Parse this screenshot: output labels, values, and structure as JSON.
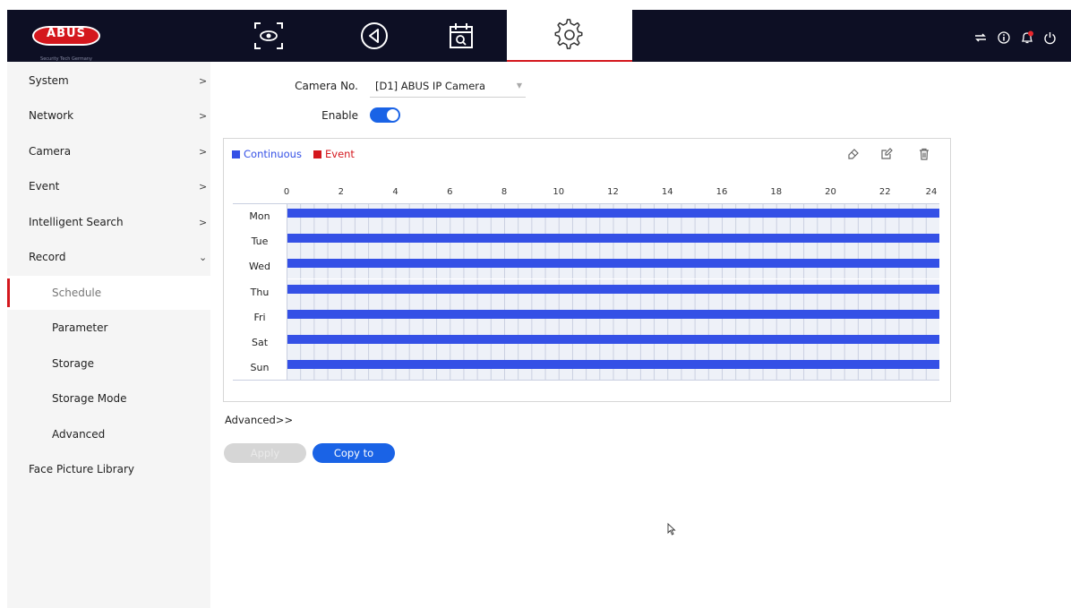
{
  "brand": {
    "logo_text": "ABUS",
    "tagline": "Security Tech Germany"
  },
  "colors": {
    "accent": "#1a63e6",
    "brand_red": "#d4171d",
    "topbar": "#0d0f24",
    "continuous": "#3450e6",
    "event": "#d4171d"
  },
  "topnav": {
    "items": [
      {
        "icon": "live-view-icon",
        "active": false
      },
      {
        "icon": "playback-icon",
        "active": false
      },
      {
        "icon": "search-calendar-icon",
        "active": false
      },
      {
        "icon": "gear-icon",
        "active": true
      }
    ],
    "right_icons": [
      "network-icon",
      "info-icon",
      "alarm-bell-icon",
      "power-icon"
    ]
  },
  "sidebar": {
    "items": [
      {
        "label": "System",
        "chevron": ">"
      },
      {
        "label": "Network",
        "chevron": ">"
      },
      {
        "label": "Camera",
        "chevron": ">"
      },
      {
        "label": "Event",
        "chevron": ">"
      },
      {
        "label": "Intelligent Search",
        "chevron": ">"
      },
      {
        "label": "Record",
        "chevron": "⌄"
      },
      {
        "label": "Schedule",
        "sub": true,
        "active": true
      },
      {
        "label": "Parameter",
        "sub": true
      },
      {
        "label": "Storage",
        "sub": true
      },
      {
        "label": "Storage Mode",
        "sub": true
      },
      {
        "label": "Advanced",
        "sub": true
      },
      {
        "label": "Face Picture Library"
      }
    ]
  },
  "form": {
    "camera_label": "Camera No.",
    "camera_value": "[D1] ABUS IP Camera",
    "enable_label": "Enable",
    "enable_on": true
  },
  "schedule": {
    "legend": {
      "continuous": "Continuous",
      "event": "Event"
    },
    "tools": [
      "eraser-icon",
      "edit-icon",
      "delete-icon"
    ],
    "hours": [
      "0",
      "2",
      "4",
      "6",
      "8",
      "10",
      "12",
      "14",
      "16",
      "18",
      "20",
      "22",
      "24"
    ],
    "days": [
      {
        "name": "Mon",
        "start": 0,
        "end": 24,
        "type": "continuous"
      },
      {
        "name": "Tue",
        "start": 0,
        "end": 24,
        "type": "continuous"
      },
      {
        "name": "Wed",
        "start": 0,
        "end": 24,
        "type": "continuous"
      },
      {
        "name": "Thu",
        "start": 0,
        "end": 24,
        "type": "continuous"
      },
      {
        "name": "Fri",
        "start": 0,
        "end": 24,
        "type": "continuous"
      },
      {
        "name": "Sat",
        "start": 0,
        "end": 24,
        "type": "continuous"
      },
      {
        "name": "Sun",
        "start": 0,
        "end": 24,
        "type": "continuous"
      }
    ]
  },
  "actions": {
    "advanced": "Advanced>>",
    "apply": "Apply",
    "copy_to": "Copy to"
  }
}
